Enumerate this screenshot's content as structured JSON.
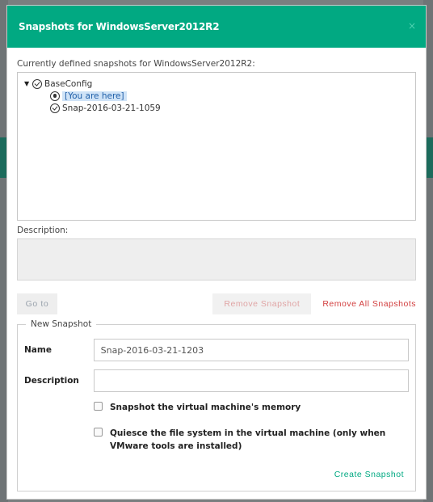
{
  "dialog": {
    "title": "Snapshots for WindowsServer2012R2",
    "close_symbol": "×"
  },
  "tree": {
    "label": "Currently defined snapshots for WindowsServer2012R2:",
    "root": {
      "label": "BaseConfig",
      "icon": "snapshot-check-icon",
      "expanded": true
    },
    "children": [
      {
        "label": "[You are here]",
        "icon": "current-position-icon",
        "selected": true
      },
      {
        "label": "Snap-2016-03-21-1059",
        "icon": "snapshot-check-icon"
      }
    ]
  },
  "description": {
    "label": "Description:",
    "value": ""
  },
  "actions": {
    "go_to": "Go to",
    "remove": "Remove Snapshot",
    "remove_all": "Remove All Snapshots"
  },
  "new_snapshot": {
    "legend": "New Snapshot",
    "name_label": "Name",
    "name_value": "Snap-2016-03-21-1203",
    "description_label": "Description",
    "description_value": "",
    "memory_label": "Snapshot the virtual machine's memory",
    "memory_checked": false,
    "quiesce_label": "Quiesce the file system in the virtual machine (only when VMware tools are installed)",
    "quiesce_checked": false,
    "create": "Create Snapshot"
  },
  "colors": {
    "title_bar": "#01a982",
    "accent": "#01a982",
    "danger": "#d23e3e",
    "selection": "#cfe3f7"
  }
}
